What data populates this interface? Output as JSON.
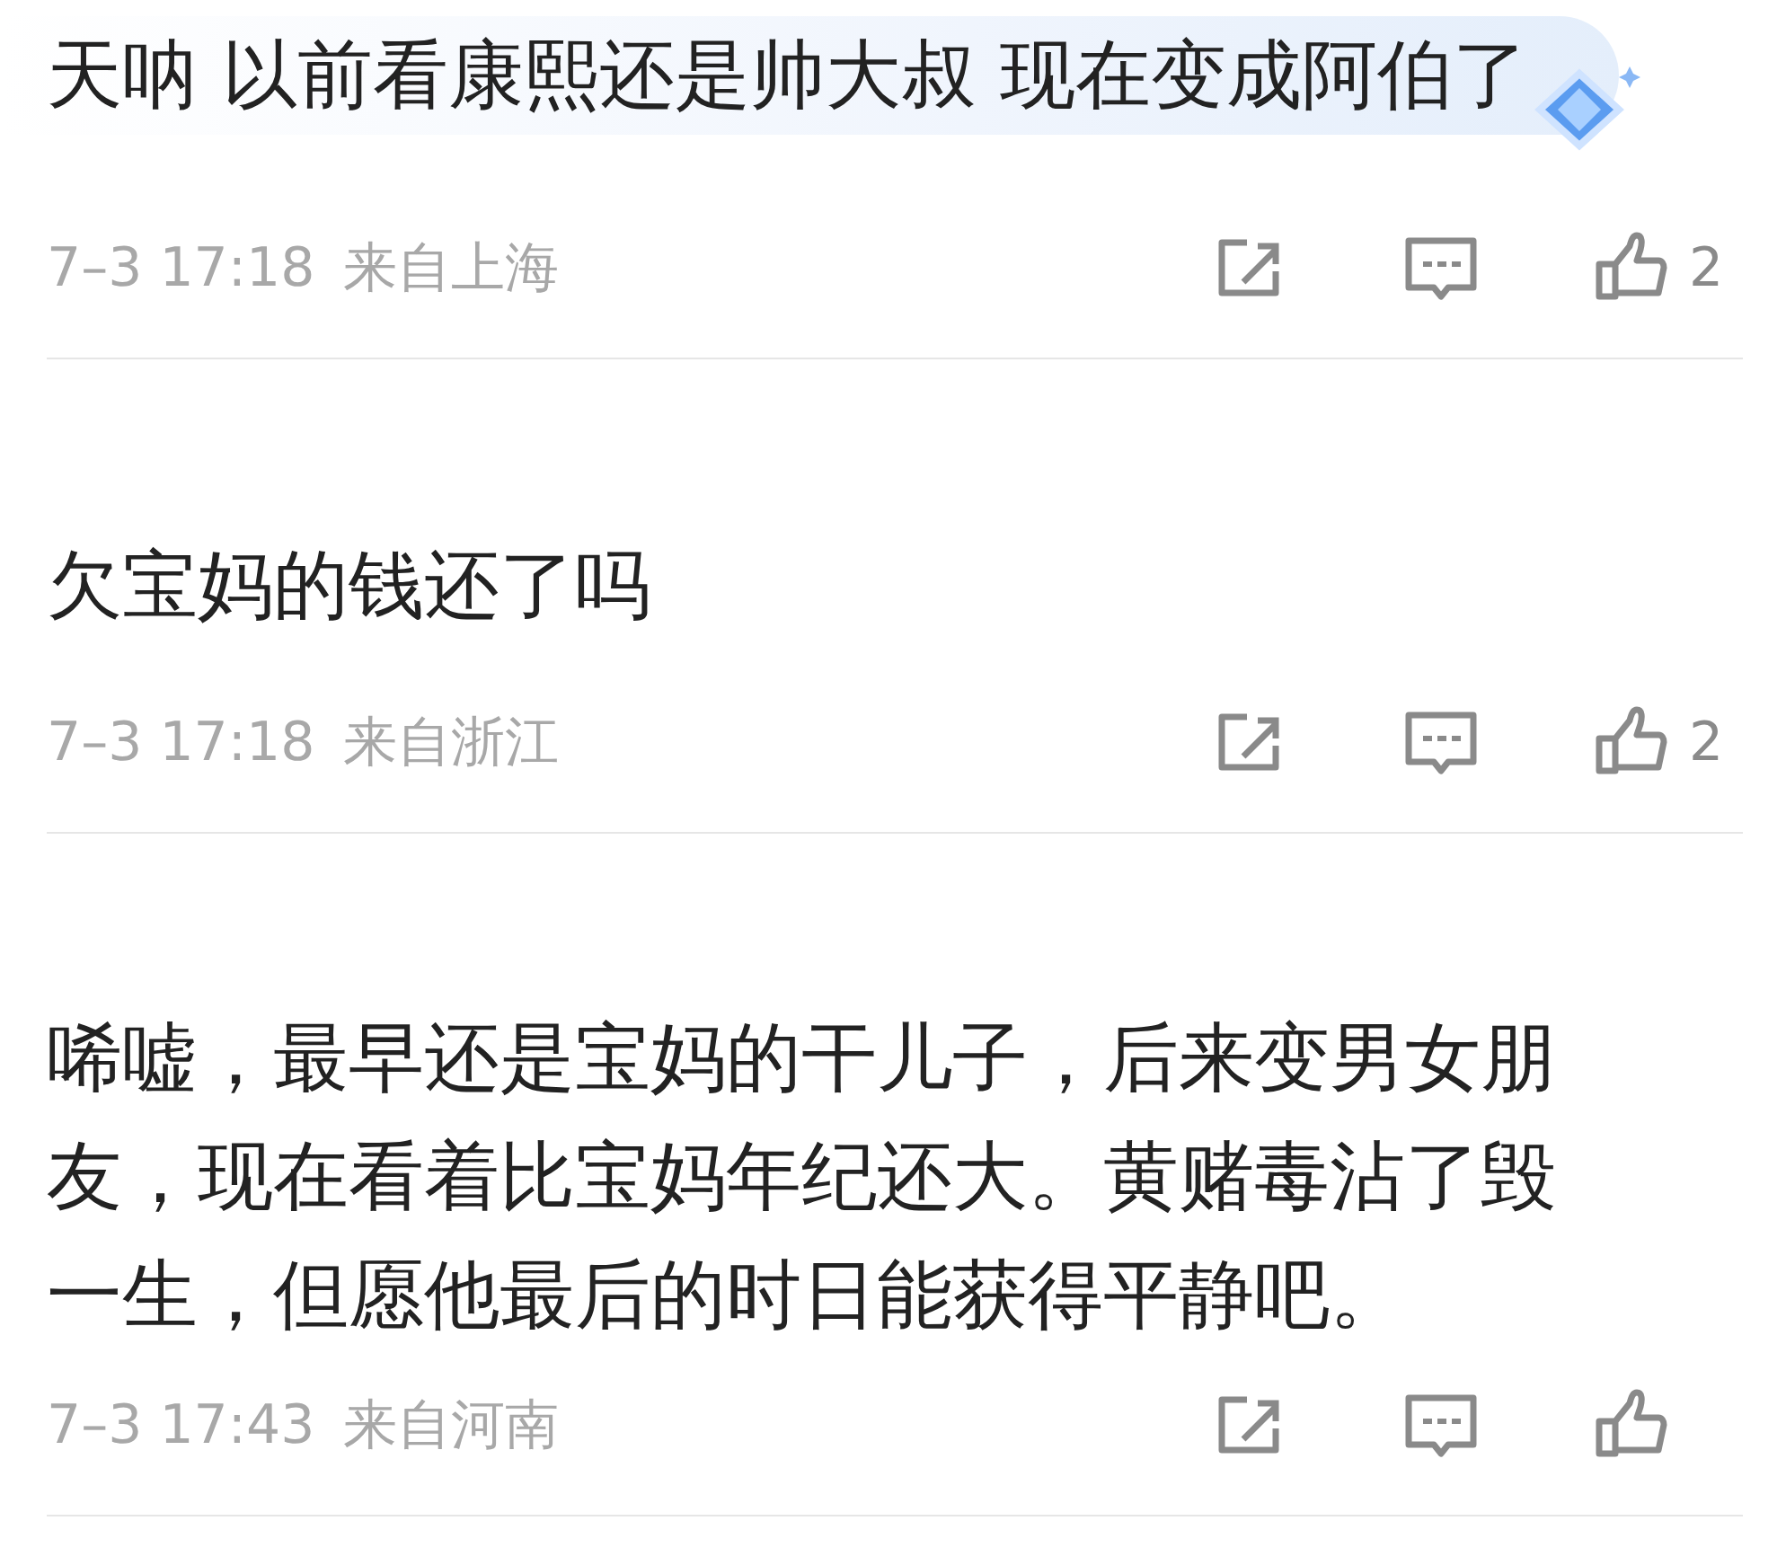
{
  "comments": [
    {
      "text": "天呐 以前看康熙还是帅大叔 现在变成阿伯了",
      "highlighted": true,
      "time": "7–3 17:18",
      "location": "来自上海",
      "likes": "2"
    },
    {
      "text": "欠宝妈的钱还了吗",
      "highlighted": false,
      "time": "7–3 17:18",
      "location": "来自浙江",
      "likes": "2"
    },
    {
      "text": "唏嘘，最早还是宝妈的干儿子，后来变男女朋友，现在看着比宝妈年纪还大。黄赌毒沾了毁一生，但愿他最后的时日能获得平静吧。",
      "highlighted": false,
      "time": "7–3 17:43",
      "location": "来自河南"
    }
  ]
}
